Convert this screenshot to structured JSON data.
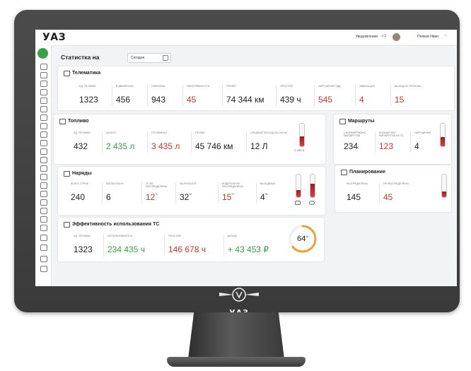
{
  "brand": "УАЗ",
  "topbar": {
    "notifications_label": "Уведомления",
    "notifications_count": "3",
    "user_name": "Полков Иван"
  },
  "header": {
    "title": "Статистка на",
    "date_value": "Сегодня"
  },
  "telematics": {
    "title": "Телематика",
    "metrics": [
      {
        "label": "ЕД. ТЕХНИКИ",
        "value": "1323"
      },
      {
        "label": "В ДВИЖЕНИИ",
        "value": "456"
      },
      {
        "label": "ПАРКОВКА",
        "value": "943"
      },
      {
        "label": "НЕИСПРАВНОСТИ",
        "value": "45"
      },
      {
        "label": "ПРОБЕГ",
        "value": "74 344 км"
      },
      {
        "label": "ПРОСТОЙ",
        "value": "439 ч"
      },
      {
        "label": "НАРУШЕНИЙ ПДД",
        "value": "545"
      },
      {
        "label": "ЭВАКУАЦИЯ",
        "value": "4"
      },
      {
        "label": "ВЫХОД ИЗ ГЕОЗОНЫ",
        "value": "15"
      }
    ]
  },
  "fuel": {
    "title": "Топливо",
    "metrics": [
      {
        "label": "ЕД. ТЕХНИКИ",
        "value": "432"
      },
      {
        "label": "ЗАЛИТО",
        "value": "2 435 л"
      },
      {
        "label": "ПОТРАЧЕНО",
        "value": "3 435 л"
      },
      {
        "label": "ПРОБЕГ",
        "value": "45 746 км"
      },
      {
        "label": "СРЕДНИЙ РАСХОД НА 100 КМ",
        "value": "12 Л"
      }
    ],
    "level_note": "- 1 430 Л",
    "level": 0.45
  },
  "routes": {
    "title": "Маршруты",
    "metrics": [
      {
        "label": "СФОРМИРОВАНО МАРШРУТОВ",
        "value": "234"
      },
      {
        "label": "БОЛЬШЕ ВСЕ МАРШРУТОВ НА ТС",
        "value": "123"
      },
      {
        "label": "НАРУШЕНИЯ",
        "value": "4"
      }
    ],
    "level": 0.4
  },
  "orders": {
    "title": "Наряды",
    "metrics": [
      {
        "label": "ВСЕГО СТРОК",
        "value": "240",
        "sup": ""
      },
      {
        "label": "АВТОКОЛОНН",
        "value": "6",
        "sup": ""
      },
      {
        "label": "ТС НЕ РАСПРЕДЕЛЕНЫ",
        "value": "12",
        "sup": "%"
      },
      {
        "label": "НА РЕМОНТЕ",
        "value": "32",
        "sup": "%"
      },
      {
        "label": "ВОДИТЕЛИ НЕ РАСПРЕДЕЛЕНЫ",
        "value": "15",
        "sup": "%"
      },
      {
        "label": "ВЫХОДНЫЕ",
        "value": "4",
        "sup": "%"
      }
    ],
    "level_a": 0.3,
    "level_b": 0.6
  },
  "planning": {
    "title": "Планирование",
    "metrics": [
      {
        "label": "РАСПРЕДЕЛЕНЫ",
        "value": "145"
      },
      {
        "label": "НЕ РАСПРЕДЕЛЕНЫ",
        "value": "45"
      }
    ],
    "level": 0.25
  },
  "efficiency": {
    "title": "Эффективность использования ТС",
    "metrics": [
      {
        "label": "ЕД. ТЕХНИКИ",
        "value": "1323"
      },
      {
        "label": "ИСПОЛЬЗОВАЛОСЬ",
        "value": "234 435 ч"
      },
      {
        "label": "ПРОСТОЙ",
        "value": "146 678 ч"
      },
      {
        "label": "ДОХОД",
        "value": "+ 43 453 ₽"
      }
    ],
    "percent_value": "64",
    "percent_sup": "%",
    "percent": 0.64
  },
  "chin_logo": "УАЗ",
  "colors": {
    "accent": "#3aa14a",
    "negative": "#c0392b",
    "ring": "#e8a23a"
  }
}
